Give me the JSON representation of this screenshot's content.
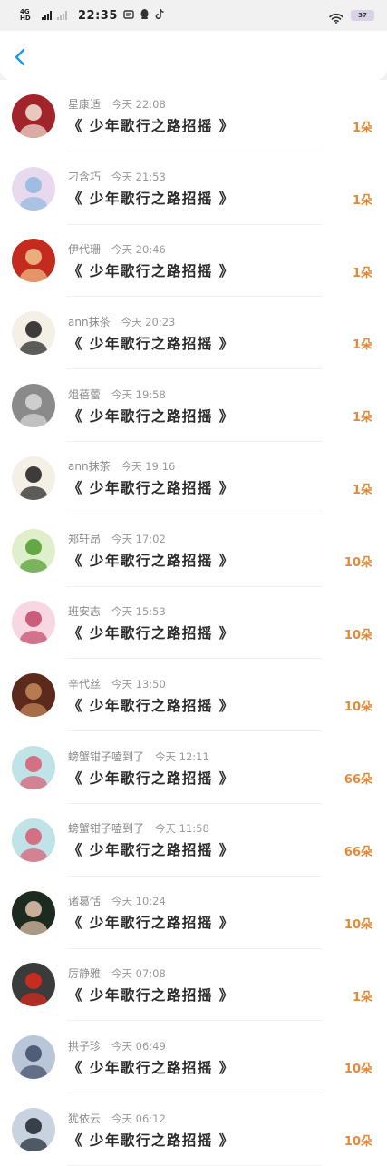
{
  "status_bar": {
    "network": "4G HD",
    "time": "22:35",
    "app_icons": [
      "message-icon",
      "qq-icon",
      "tiktok-icon"
    ],
    "battery": "37"
  },
  "nav": {
    "back_icon": "chevron-left-icon",
    "accent": "#1e9be0"
  },
  "items": [
    {
      "name": "星康适",
      "time": "今天 22:08",
      "title": "《 少年歌行之路招摇 》",
      "count": "1朵"
    },
    {
      "name": "刁含巧",
      "time": "今天 21:53",
      "title": "《 少年歌行之路招摇 》",
      "count": "1朵"
    },
    {
      "name": "伊代珊",
      "time": "今天 20:46",
      "title": "《 少年歌行之路招摇 》",
      "count": "1朵"
    },
    {
      "name": "ann抹茶",
      "time": "今天 20:23",
      "title": "《 少年歌行之路招摇 》",
      "count": "1朵"
    },
    {
      "name": "俎蓓蕾",
      "time": "今天 19:58",
      "title": "《 少年歌行之路招摇 》",
      "count": "1朵"
    },
    {
      "name": "ann抹茶",
      "time": "今天 19:16",
      "title": "《 少年歌行之路招摇 》",
      "count": "1朵"
    },
    {
      "name": "郑轩昂",
      "time": "今天 17:02",
      "title": "《 少年歌行之路招摇 》",
      "count": "10朵"
    },
    {
      "name": "班安志",
      "time": "今天 15:53",
      "title": "《 少年歌行之路招摇 》",
      "count": "10朵"
    },
    {
      "name": "辛代丝",
      "time": "今天 13:50",
      "title": "《 少年歌行之路招摇 》",
      "count": "10朵"
    },
    {
      "name": "螃蟹钳子嗑到了",
      "time": "今天 12:11",
      "title": "《 少年歌行之路招摇 》",
      "count": "66朵"
    },
    {
      "name": "螃蟹钳子嗑到了",
      "time": "今天 11:58",
      "title": "《 少年歌行之路招摇 》",
      "count": "66朵"
    },
    {
      "name": "诸葛恬",
      "time": "今天 10:24",
      "title": "《 少年歌行之路招摇 》",
      "count": "10朵"
    },
    {
      "name": "厉静雅",
      "time": "今天 07:08",
      "title": "《 少年歌行之路招摇 》",
      "count": "1朵"
    },
    {
      "name": "拱子珍",
      "time": "今天 06:49",
      "title": "《 少年歌行之路招摇 》",
      "count": "10朵"
    },
    {
      "name": "犹依云",
      "time": "今天 06:12",
      "title": "《 少年歌行之路招摇 》",
      "count": "10朵"
    }
  ],
  "avatars": [
    {
      "bg": "#a1242a",
      "fg": "#f4e6d8"
    },
    {
      "bg": "#e9d9ee",
      "fg": "#8fb8de"
    },
    {
      "bg": "#c22b1e",
      "fg": "#f2c48a"
    },
    {
      "bg": "#f4f0e6",
      "fg": "#1c1c1c"
    },
    {
      "bg": "#8a8a8a",
      "fg": "#d9d9d9"
    },
    {
      "bg": "#f4f0e6",
      "fg": "#1c1c1c"
    },
    {
      "bg": "#dfeecb",
      "fg": "#4f9a2e"
    },
    {
      "bg": "#f7d7e2",
      "fg": "#c24869"
    },
    {
      "bg": "#5b2a1c",
      "fg": "#c88a5a"
    },
    {
      "bg": "#bfe3e6",
      "fg": "#d85a72"
    },
    {
      "bg": "#bfe3e6",
      "fg": "#d85a72"
    },
    {
      "bg": "#1d2a1f",
      "fg": "#e8c7b0"
    },
    {
      "bg": "#3b3b3b",
      "fg": "#e02a1d"
    },
    {
      "bg": "#b9c6d8",
      "fg": "#3c4a66"
    },
    {
      "bg": "#c9d3e0",
      "fg": "#1e2430"
    }
  ],
  "count_color": "#e2893a"
}
